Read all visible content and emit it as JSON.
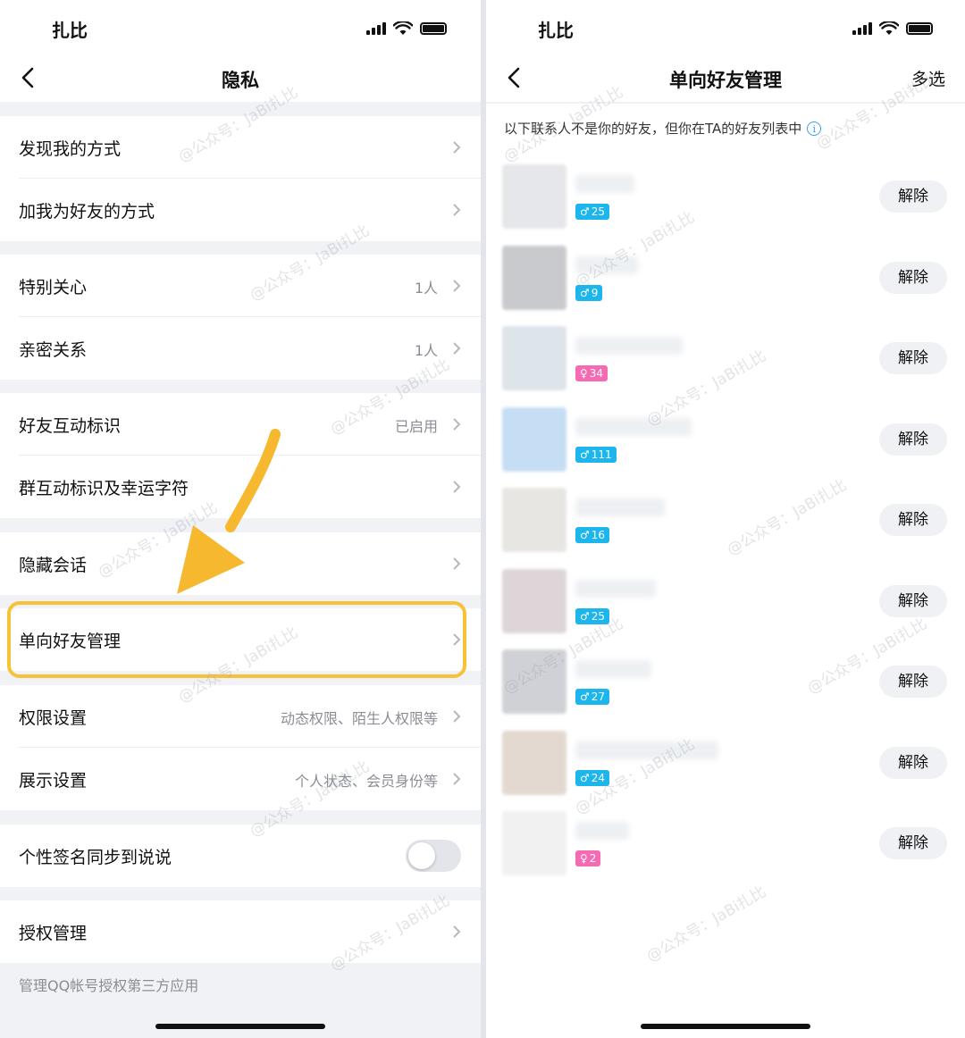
{
  "left_screen": {
    "status": {
      "time": "扎比"
    },
    "nav": {
      "title": "隐私"
    },
    "rows": [
      {
        "label": "发现我的方式",
        "value": ""
      },
      {
        "label": "加我为好友的方式",
        "value": ""
      },
      {
        "label": "特别关心",
        "value": "1人"
      },
      {
        "label": "亲密关系",
        "value": "1人"
      },
      {
        "label": "好友互动标识",
        "value": "已启用"
      },
      {
        "label": "群互动标识及幸运字符",
        "value": ""
      },
      {
        "label": "隐藏会话",
        "value": ""
      },
      {
        "label": "单向好友管理",
        "value": ""
      },
      {
        "label": "权限设置",
        "value": "动态权限、陌生人权限等"
      },
      {
        "label": "展示设置",
        "value": "个人状态、会员身份等"
      },
      {
        "label": "个性签名同步到说说",
        "value": "",
        "toggle": "off"
      },
      {
        "label": "授权管理",
        "value": ""
      }
    ],
    "footer_note": "管理QQ帐号授权第三方应用"
  },
  "right_screen": {
    "status": {
      "time": "扎比"
    },
    "nav": {
      "title": "单向好友管理",
      "action": "多选"
    },
    "info_text": "以下联系人不是你的好友，但你在TA的好友列表中",
    "friends": [
      {
        "gender": "male",
        "age": "25",
        "button": "解除",
        "avatar_color": "#e6e7ea"
      },
      {
        "gender": "male",
        "age": "9",
        "button": "解除",
        "avatar_color": "#c9cacd"
      },
      {
        "gender": "female",
        "age": "34",
        "button": "解除",
        "avatar_color": "#dde4ea"
      },
      {
        "gender": "male",
        "age": "111",
        "button": "解除",
        "avatar_color": "#c6def4"
      },
      {
        "gender": "male",
        "age": "16",
        "button": "解除",
        "avatar_color": "#e8e6e3"
      },
      {
        "gender": "male",
        "age": "25",
        "button": "解除",
        "avatar_color": "#ddd5d8"
      },
      {
        "gender": "male",
        "age": "27",
        "button": "解除",
        "avatar_color": "#cfd1d6"
      },
      {
        "gender": "male",
        "age": "24",
        "button": "解除",
        "avatar_color": "#e3d9d0"
      },
      {
        "gender": "female",
        "age": "2",
        "button": "解除",
        "avatar_color": "#f1f1f2"
      }
    ]
  },
  "watermark": "@公众号：JaBi扎比",
  "colors": {
    "highlight": "#f7c23a",
    "male_badge": "#1cb6ec",
    "female_badge": "#f66ab3",
    "info_icon": "#3aa0e8"
  },
  "icons": [
    "back-chevron-icon",
    "chevron-right-icon",
    "signal-icon",
    "wifi-icon",
    "battery-icon",
    "info-icon",
    "male-icon",
    "female-icon",
    "arrow-pointer-icon"
  ]
}
